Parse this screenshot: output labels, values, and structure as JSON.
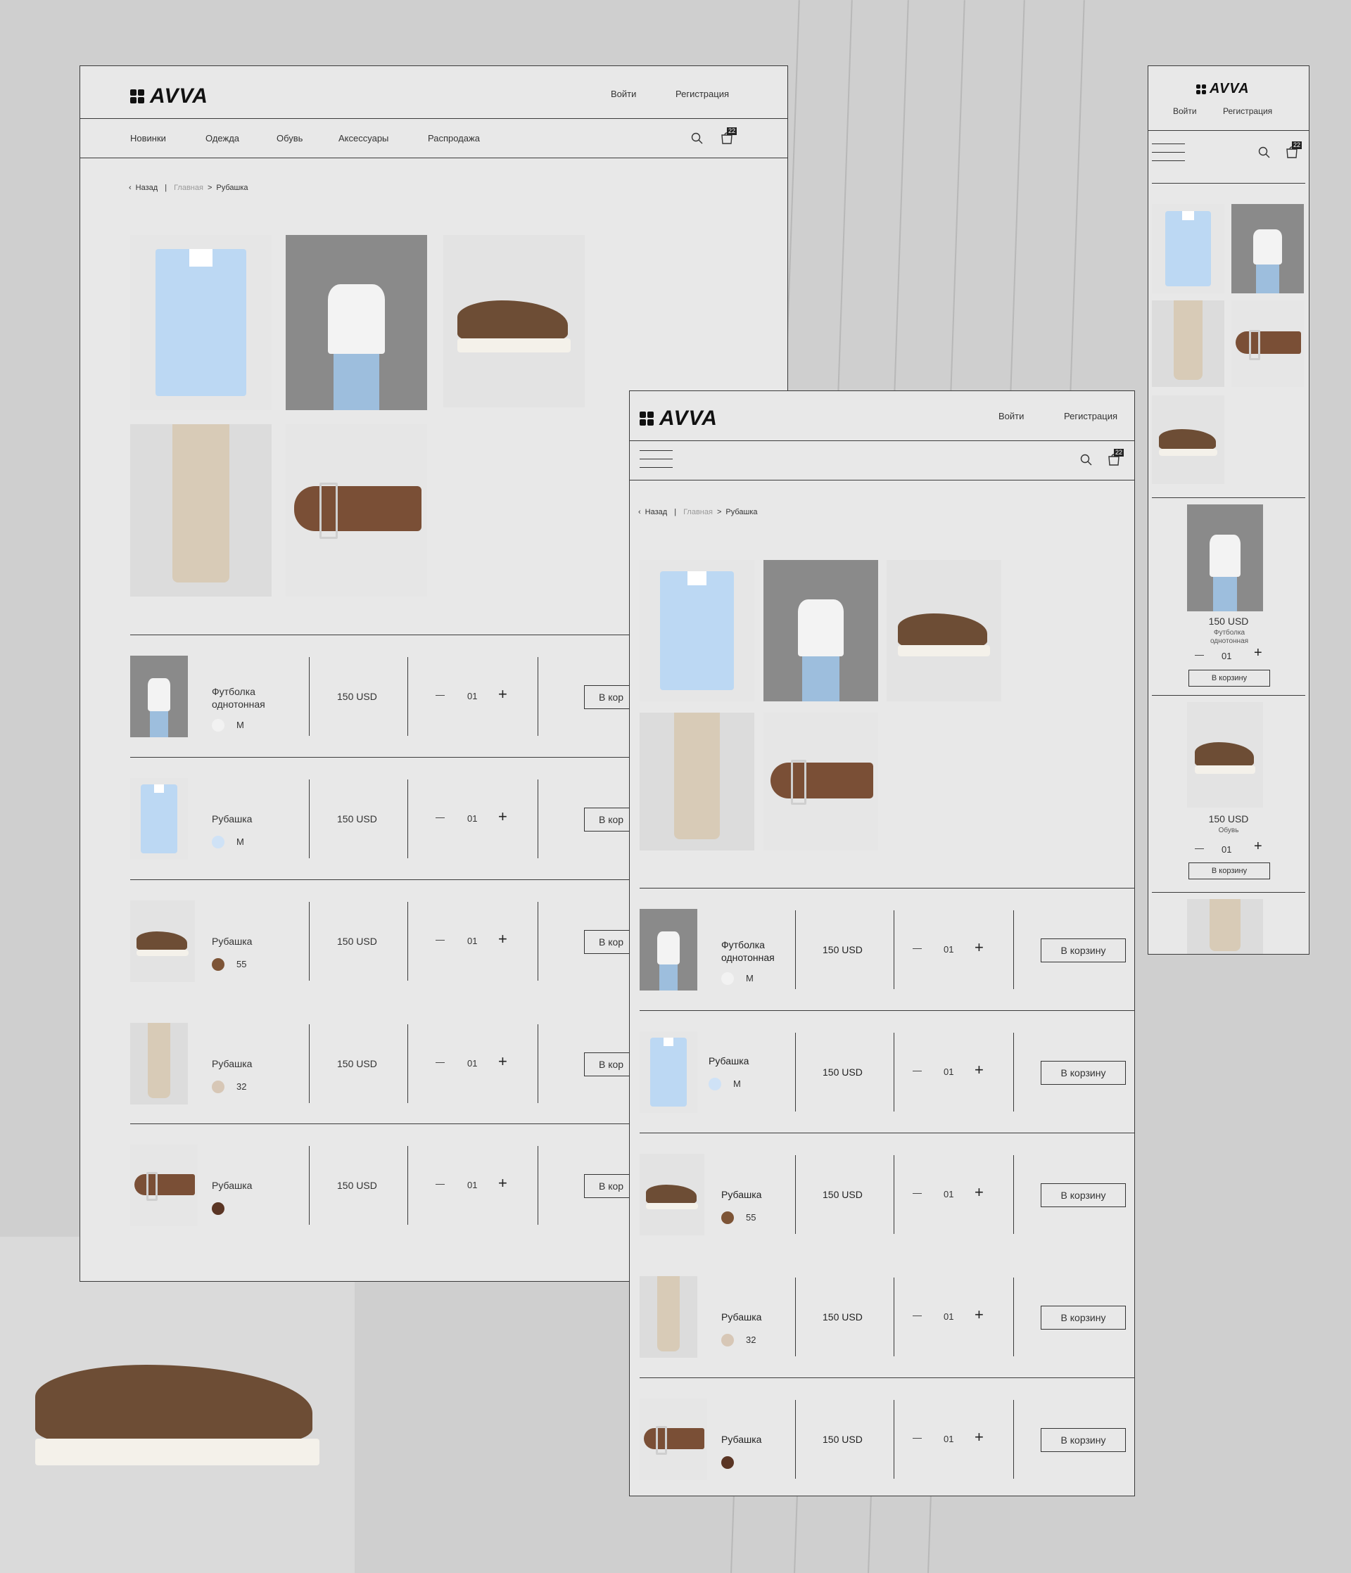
{
  "brand": "AVVA",
  "header": {
    "login": "Войти",
    "register": "Регистрация"
  },
  "nav": [
    "Новинки",
    "Одежда",
    "Обувь",
    "Аксессуары",
    "Распродажа"
  ],
  "cart_count": "22",
  "breadcrumb": {
    "back": "Назад",
    "separator": "|",
    "home": "Главная",
    "arrow": ">",
    "current": "Рубашка"
  },
  "cart_items": [
    {
      "name": "Футболка однотонная",
      "size": "M",
      "color": "#f2f2f2",
      "price": "150 USD",
      "qty": "01"
    },
    {
      "name": "Рубашка",
      "size": "M",
      "color": "#cfe2f6",
      "price": "150 USD",
      "qty": "01"
    },
    {
      "name": "Рубашка",
      "size": "55",
      "color": "#7d5436",
      "price": "150 USD",
      "qty": "01"
    },
    {
      "name": "Рубашка",
      "size": "32",
      "color": "#d7c7b6",
      "price": "150 USD",
      "qty": "01"
    },
    {
      "name": "Рубашка",
      "size": "",
      "color": "#5a3524",
      "price": "150 USD",
      "qty": "01"
    }
  ],
  "controls": {
    "minus": "—",
    "plus": "+",
    "add_to_cart": "В корзину",
    "add_to_cart_cut": "В кор"
  },
  "mobile_cards": [
    {
      "price": "150 USD",
      "name": "Футболка однотонная",
      "qty": "01"
    },
    {
      "price": "150 USD",
      "name": "Обувь",
      "qty": "01"
    }
  ]
}
